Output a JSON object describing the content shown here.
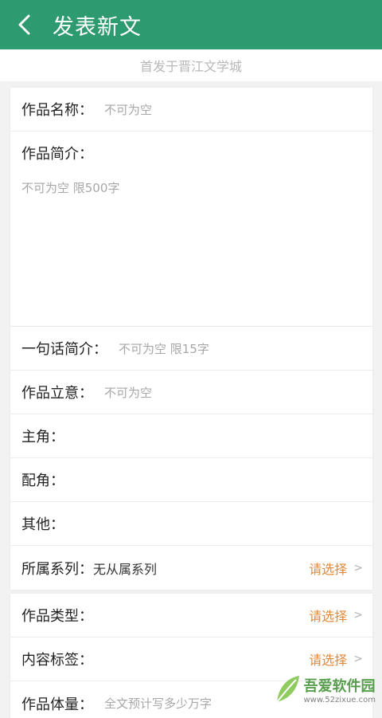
{
  "header": {
    "title": "发表新文"
  },
  "subtitle": "首发于晋江文学城",
  "form": {
    "name": {
      "label": "作品名称",
      "placeholder": "不可为空"
    },
    "intro": {
      "label": "作品简介：",
      "placeholder": "不可为空 限500字"
    },
    "oneline": {
      "label": "一句话简介",
      "placeholder": "不可为空 限15字"
    },
    "theme": {
      "label": "作品立意",
      "placeholder": "不可为空"
    },
    "protagonist": {
      "label": "主角："
    },
    "supporting": {
      "label": "配角："
    },
    "others": {
      "label": "其他："
    },
    "series": {
      "label": "所属系列：",
      "value": "无从属系列",
      "action": "请选择"
    },
    "type": {
      "label": "作品类型：",
      "action": "请选择"
    },
    "tags": {
      "label": "内容标签：",
      "action": "请选择"
    },
    "volume": {
      "label": "作品体量",
      "placeholder": "全文预计写多少万字"
    }
  },
  "watermark": {
    "main": "吾爱软件园",
    "url": "www.52zixue.com"
  },
  "colors": {
    "header": "#2e9a6f",
    "accent": "#e0893a"
  }
}
